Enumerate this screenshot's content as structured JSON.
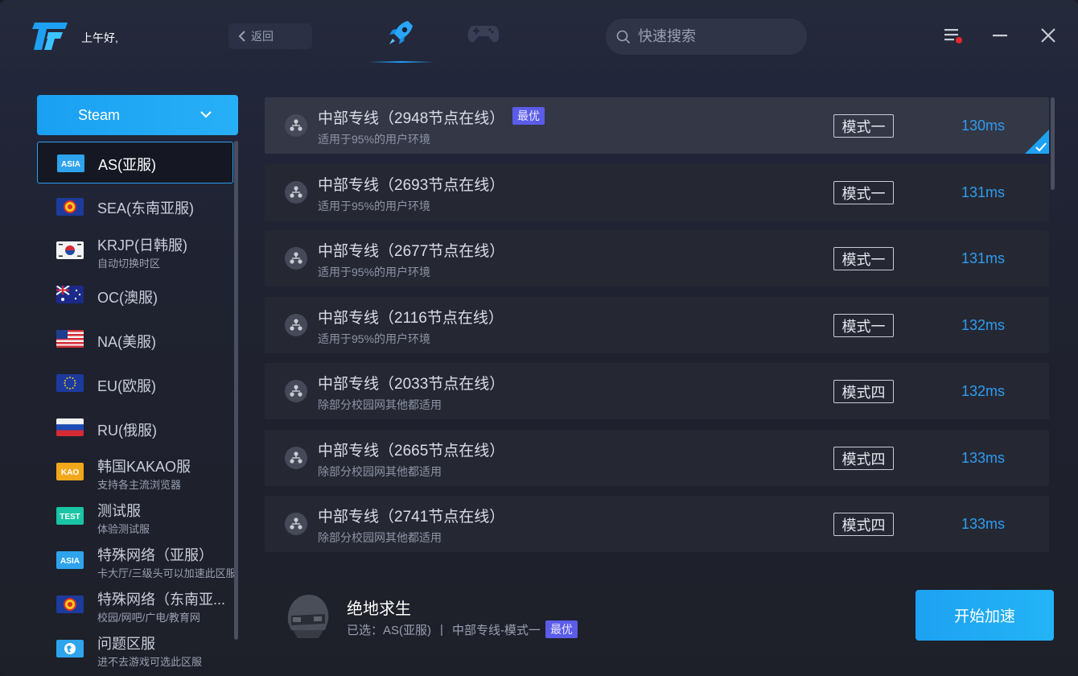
{
  "header": {
    "greeting": "上午好,",
    "back_label": "返回",
    "search_placeholder": "快速搜索",
    "tabs": [
      {
        "icon": "rocket-icon",
        "active": true
      },
      {
        "icon": "gamepad-icon",
        "active": false
      }
    ],
    "window_controls": [
      "menu-icon",
      "minimize-icon",
      "close-icon"
    ],
    "notification_dot_color": "#e8262e"
  },
  "sidebar": {
    "platform_select": "Steam",
    "servers": [
      {
        "badge": "ASIA",
        "name": "AS(亚服)",
        "sub": "",
        "active": true
      },
      {
        "badge": "",
        "flag": "asean",
        "name": "SEA(东南亚服)",
        "sub": ""
      },
      {
        "badge": "",
        "flag": "korea",
        "name": "KRJP(日韩服)",
        "sub": "自动切换时区"
      },
      {
        "badge": "",
        "flag": "australia",
        "name": "OC(澳服)",
        "sub": ""
      },
      {
        "badge": "",
        "flag": "usa",
        "name": "NA(美服)",
        "sub": ""
      },
      {
        "badge": "",
        "flag": "eu",
        "name": "EU(欧服)",
        "sub": ""
      },
      {
        "badge": "",
        "flag": "russia",
        "name": "RU(俄服)",
        "sub": ""
      },
      {
        "badge": "KAO",
        "name": "韩国KAKAO服",
        "sub": "支持各主流浏览器"
      },
      {
        "badge": "TEST",
        "name": "测试服",
        "sub": "体验测试服"
      },
      {
        "badge": "ASIA",
        "name": "特殊网络（亚服）",
        "sub": "卡大厅/三级头可以加速此区服"
      },
      {
        "badge": "",
        "flag": "asean",
        "name": "特殊网络（东南亚...",
        "sub": "校园/网吧/广电/教育网"
      },
      {
        "badge": "",
        "flag": "globe",
        "name": "问题区服",
        "sub": "进不去游戏可选此区服"
      }
    ]
  },
  "nodes": [
    {
      "title": "中部专线（2948节点在线）",
      "desc": "适用于95%的用户环境",
      "mode": "模式一",
      "ping": "130ms",
      "best": "最优",
      "selected": true
    },
    {
      "title": "中部专线（2693节点在线）",
      "desc": "适用于95%的用户环境",
      "mode": "模式一",
      "ping": "131ms"
    },
    {
      "title": "中部专线（2677节点在线）",
      "desc": "适用于95%的用户环境",
      "mode": "模式一",
      "ping": "131ms"
    },
    {
      "title": "中部专线（2116节点在线）",
      "desc": "适用于95%的用户环境",
      "mode": "模式一",
      "ping": "132ms"
    },
    {
      "title": "中部专线（2033节点在线）",
      "desc": "除部分校园网其他都适用",
      "mode": "模式四",
      "ping": "132ms"
    },
    {
      "title": "中部专线（2665节点在线）",
      "desc": "除部分校园网其他都适用",
      "mode": "模式四",
      "ping": "133ms"
    },
    {
      "title": "中部专线（2741节点在线）",
      "desc": "除部分校园网其他都适用",
      "mode": "模式四",
      "ping": "133ms"
    }
  ],
  "footer": {
    "game_title": "绝地求生",
    "selected_prefix": "已选：",
    "selected_region": "AS(亚服)",
    "separator": "|",
    "selected_node": "中部专线-模式一",
    "selected_badge": "最优",
    "start_label": "开始加速"
  },
  "colors": {
    "accent": "#1ea1f2",
    "ping": "#2e9cf1",
    "best_badge": "#5b5ce8"
  }
}
